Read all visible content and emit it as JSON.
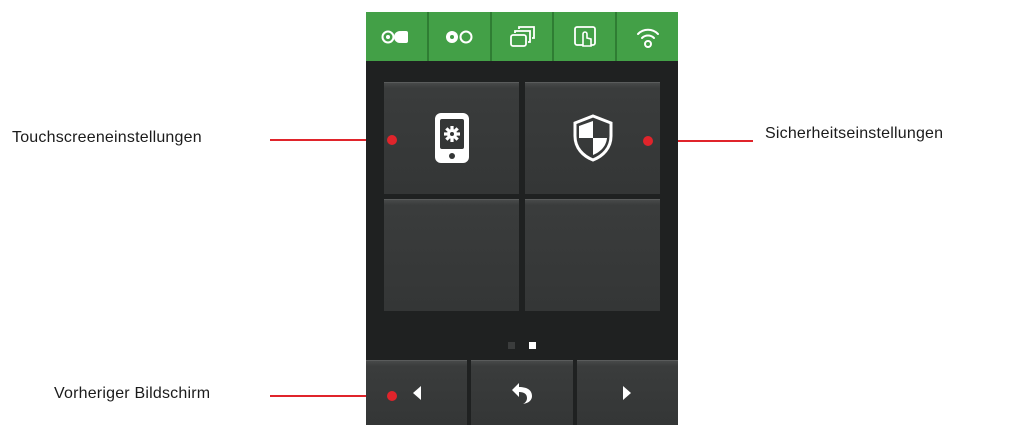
{
  "annotations": {
    "touchscreen": "Touchscreeneinstellungen",
    "security": "Sicherheitseinstellungen",
    "previous": "Vorheriger Bildschirm"
  },
  "colors": {
    "topbar": "#43a047",
    "annotation_line": "#e0242b",
    "device_bg": "#1f2121",
    "tile": "#3a3c3c"
  },
  "topbar": {
    "icons": [
      "ribbon-label-icon",
      "ribbon-icon",
      "stack-icon",
      "touch-screen-icon",
      "wifi-icon"
    ]
  },
  "tiles": [
    {
      "icon": "touchscreen-settings-icon"
    },
    {
      "icon": "security-shield-icon"
    },
    {
      "icon": ""
    },
    {
      "icon": ""
    }
  ],
  "pager": {
    "pages": 2,
    "current": 2
  },
  "bottombar": {
    "icons": [
      "arrow-left-icon",
      "return-icon",
      "arrow-right-icon"
    ]
  }
}
